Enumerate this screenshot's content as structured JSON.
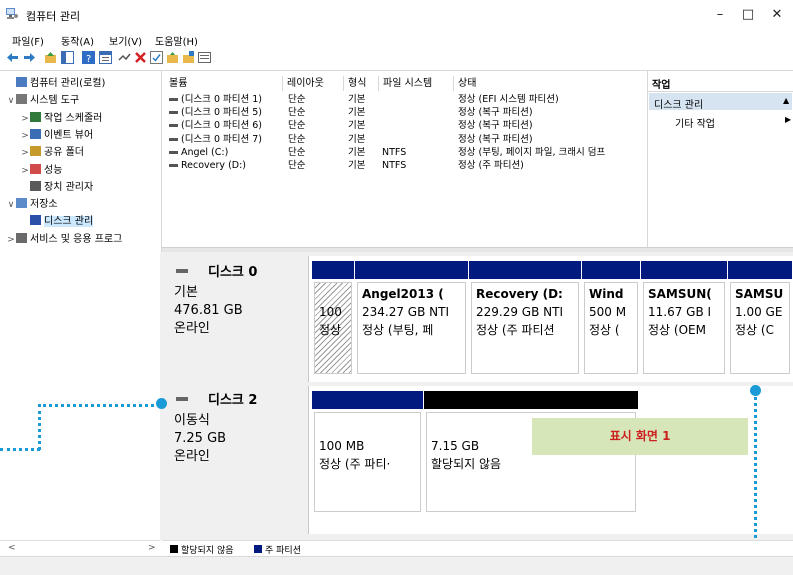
{
  "window": {
    "title": "컴퓨터 관리",
    "minimize": "–",
    "maximize": "□",
    "close": "✕"
  },
  "menu": [
    "파일(F)",
    "동작(A)",
    "보기(V)",
    "도움말(H)"
  ],
  "toolbar": {
    "icons": [
      "back-icon",
      "forward-icon",
      "up-folder-icon",
      "show-hide-tree-icon",
      "help-icon",
      "properties-icon",
      "connect-icon",
      "delete-icon",
      "check-icon",
      "open-folder-icon",
      "search-folder-icon",
      "list-view-icon"
    ]
  },
  "tree": {
    "items": [
      {
        "label": "컴퓨터 관리(로컬)",
        "arrow": "",
        "icon": "computer-management-icon",
        "indent": 0
      },
      {
        "label": "시스템 도구",
        "arrow": "∨",
        "icon": "system-tools-icon",
        "indent": 0
      },
      {
        "label": "작업 스케줄러",
        "arrow": ">",
        "icon": "task-scheduler-icon",
        "indent": 1
      },
      {
        "label": "이벤트 뷰어",
        "arrow": ">",
        "icon": "event-viewer-icon",
        "indent": 1
      },
      {
        "label": "공유 폴더",
        "arrow": ">",
        "icon": "shared-folders-icon",
        "indent": 1
      },
      {
        "label": "성능",
        "arrow": ">",
        "icon": "performance-icon",
        "indent": 1
      },
      {
        "label": "장치 관리자",
        "arrow": "",
        "icon": "device-manager-icon",
        "indent": 1
      },
      {
        "label": "저장소",
        "arrow": "∨",
        "icon": "storage-icon",
        "indent": 0
      },
      {
        "label": "디스크 관리",
        "arrow": "",
        "icon": "disk-management-icon",
        "indent": 1,
        "selected": true
      },
      {
        "label": "서비스 및 응용 프로그",
        "arrow": ">",
        "icon": "services-icon",
        "indent": 0
      }
    ]
  },
  "volume_table": {
    "headers": [
      "볼륨",
      "레이아웃",
      "형식",
      "파일 시스템",
      "상태"
    ],
    "rows": [
      {
        "volume": "(디스크 0 파티션 1)",
        "layout": "단순",
        "type": "기본",
        "fs": "",
        "status": "정상 (EFI 시스템 파티션)"
      },
      {
        "volume": "(디스크 0 파티션 5)",
        "layout": "단순",
        "type": "기본",
        "fs": "",
        "status": "정상 (복구 파티션)"
      },
      {
        "volume": "(디스크 0 파티션 6)",
        "layout": "단순",
        "type": "기본",
        "fs": "",
        "status": "정상 (복구 파티션)"
      },
      {
        "volume": "(디스크 0 파티션 7)",
        "layout": "단순",
        "type": "기본",
        "fs": "",
        "status": "정상 (복구 파티션)"
      },
      {
        "volume": "Angel (C:)",
        "layout": "단순",
        "type": "기본",
        "fs": "NTFS",
        "status": "정상 (부팅, 페이지 파일, 크래시 덤프"
      },
      {
        "volume": "Recovery (D:)",
        "layout": "단순",
        "type": "기본",
        "fs": "NTFS",
        "status": "정상 (주 파티션)"
      }
    ]
  },
  "actions": {
    "header": "작업",
    "section": "디스크 관리",
    "more": "기타 작업",
    "section_arrow": "▲",
    "more_arrow": "▶"
  },
  "disks": [
    {
      "name": "디스크 0",
      "type": "기본",
      "size": "476.81 GB",
      "status": "온라인",
      "partitions": [
        {
          "name": "",
          "size": "100",
          "status": "정상",
          "hatched": true,
          "bar": "blue"
        },
        {
          "name": "Angel2013  (",
          "size": "234.27 GB NTI",
          "status": "정상 (부팅, 페",
          "bar": "blue"
        },
        {
          "name": "Recovery  (D:",
          "size": "229.29 GB NTI",
          "status": "정상 (주 파티션",
          "bar": "blue"
        },
        {
          "name": "Wind",
          "size": "500 M",
          "status": "정상 (",
          "bar": "blue"
        },
        {
          "name": "SAMSUN(",
          "size": "11.67 GB I",
          "status": "정상 (OEM",
          "bar": "blue"
        },
        {
          "name": "SAMSU",
          "size": "1.00 GE",
          "status": "정상 (C",
          "bar": "blue"
        }
      ]
    },
    {
      "name": "디스크 2",
      "type": "이동식",
      "size": "7.25 GB",
      "status": "온라인",
      "partitions": [
        {
          "name": "",
          "size": "100 MB",
          "status": "정상 (주 파티·",
          "bar": "blue"
        },
        {
          "name": "",
          "size": "7.15 GB",
          "status": "할당되지 않음",
          "bar": "black"
        }
      ]
    }
  ],
  "callout": "표시 화면 1",
  "legend": [
    {
      "label": "할당되지 않음",
      "color": "#000000"
    },
    {
      "label": "주 파티션",
      "color": "#001a80"
    }
  ],
  "colors": {
    "primary_partition": "#001a80",
    "unallocated": "#000000",
    "callout_bg": "#d7e6b9",
    "callout_text": "#cc1f1f",
    "dotted_line": "#1a9ad6",
    "selection": "#cce8ff"
  }
}
